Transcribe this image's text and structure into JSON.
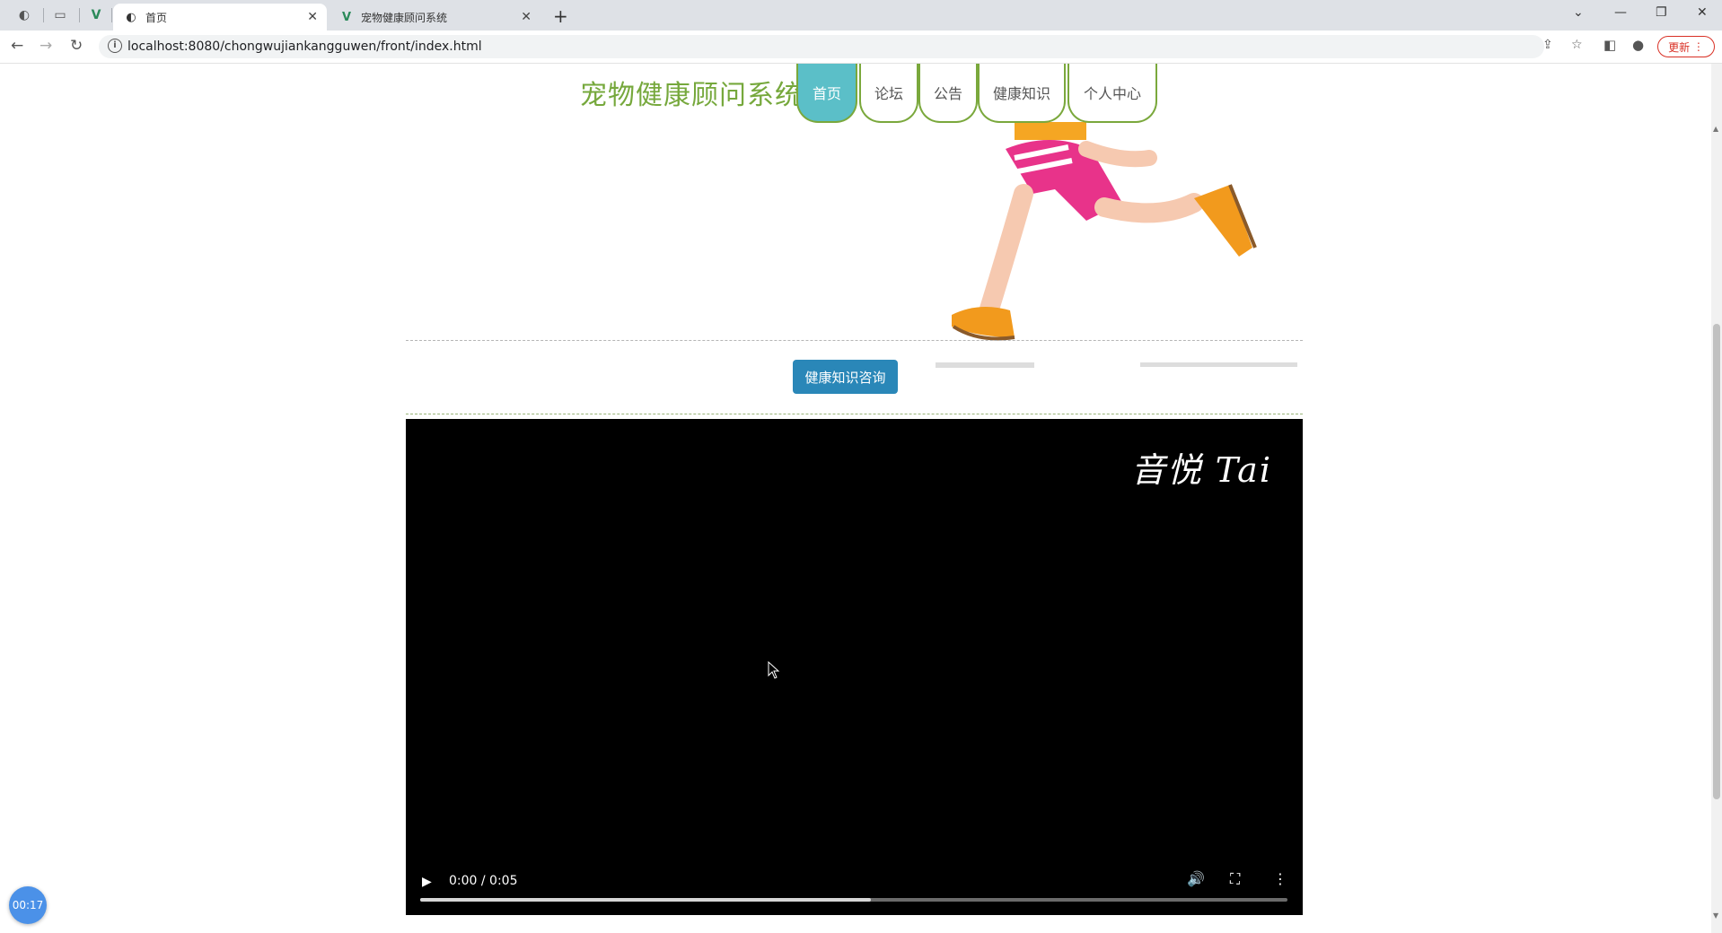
{
  "browser": {
    "tabs": [
      {
        "title": "首页",
        "active": true
      },
      {
        "title": "宠物健康顾问系统",
        "active": false
      }
    ],
    "url": "localhost:8080/chongwujiankangguwen/front/index.html",
    "update_label": "更新"
  },
  "site": {
    "title": "宠物健康顾问系统",
    "nav": [
      {
        "label": "首页",
        "active": true
      },
      {
        "label": "论坛",
        "active": false
      },
      {
        "label": "公告",
        "active": false
      },
      {
        "label": "健康知识",
        "active": false
      },
      {
        "label": "个人中心",
        "active": false
      }
    ],
    "consult_button": "健康知识咨询"
  },
  "video": {
    "watermark": "音悦 Tai",
    "time": "0:00 / 0:05",
    "buffered_fraction": 0.52
  },
  "recorder": {
    "timer": "00:17"
  },
  "colors": {
    "title_green": "#76a83c",
    "nav_active": "#5bbfc8",
    "button_blue": "#2a87b8"
  }
}
